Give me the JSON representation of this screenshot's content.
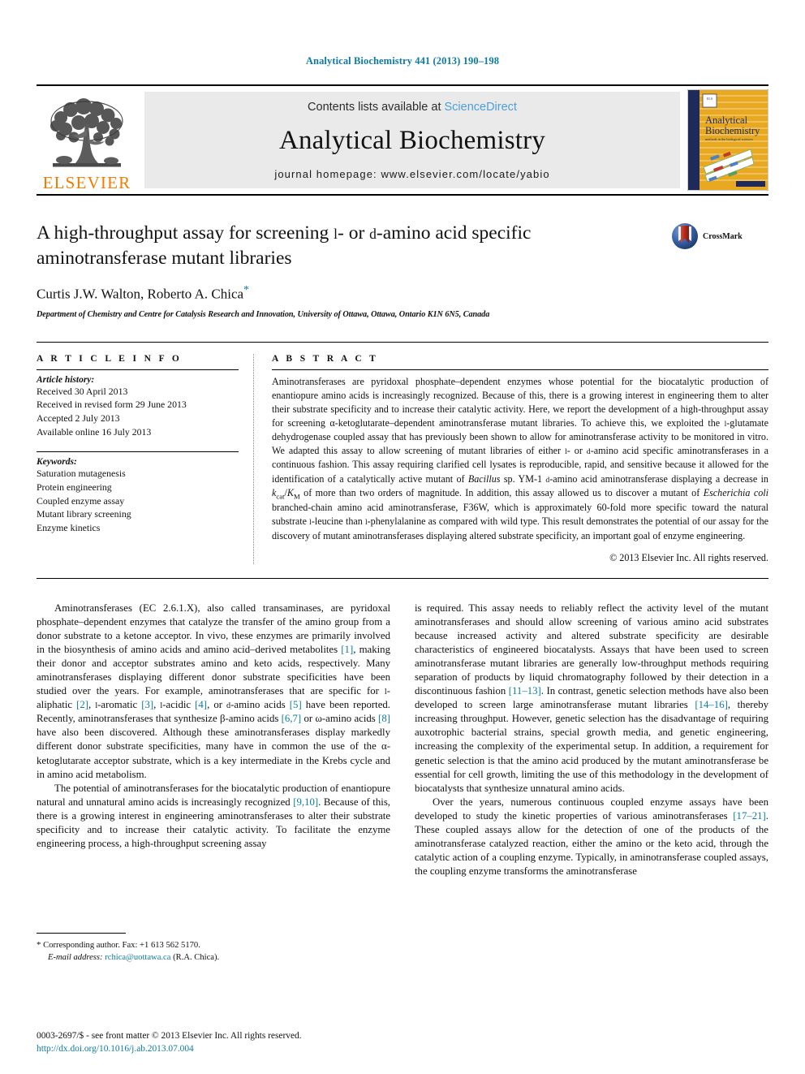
{
  "running_head": "Analytical Biochemistry 441 (2013) 190–198",
  "masthead": {
    "publisher_name": "ELSEVIER",
    "contents_prefix": "Contents lists available at ",
    "sciencedirect": "ScienceDirect",
    "journal_title": "Analytical Biochemistry",
    "homepage": "journal homepage: www.elsevier.com/locate/yabio",
    "cover_title_line1": "Analytical",
    "cover_title_line2": "Biochemistry",
    "cover_subtitle": "methods in the biological sciences",
    "colors": {
      "elsevier_orange": "#f07d00",
      "link_blue": "#4d9fd6",
      "accent_teal": "#0d7ba3",
      "masthead_grey": "#eaeaea",
      "cover_navy": "#1e2a5a",
      "cover_gold": "#e8a921"
    }
  },
  "title": {
    "line1_a": "A high-throughput assay for screening ",
    "line1_sc1": "l",
    "line1_b": "- or ",
    "line1_sc2": "d",
    "line1_c": "-amino acid specific",
    "line2": "aminotransferase mutant libraries",
    "full": "A high-throughput assay for screening L- or D-amino acid specific aminotransferase mutant libraries"
  },
  "authors": {
    "names": "Curtis J.W. Walton, Roberto A. Chica",
    "corresponding_marker": "*"
  },
  "affiliation": "Department of Chemistry and Centre for Catalysis Research and Innovation, University of Ottawa, Ottawa, Ontario K1N 6N5, Canada",
  "crossmark": {
    "label": "CrossMark"
  },
  "article_info": {
    "heading": "A R T I C L E   I N F O",
    "history_label": "Article history:",
    "history": [
      "Received 30 April 2013",
      "Received in revised form 29 June 2013",
      "Accepted 2 July 2013",
      "Available online 16 July 2013"
    ],
    "keywords_label": "Keywords:",
    "keywords": [
      "Saturation mutagenesis",
      "Protein engineering",
      "Coupled enzyme assay",
      "Mutant library screening",
      "Enzyme kinetics"
    ]
  },
  "abstract": {
    "heading": "A B S T R A C T",
    "parts": [
      {
        "t": "text",
        "v": "Aminotransferases are pyridoxal phosphate–dependent enzymes whose potential for the biocatalytic production of enantiopure amino acids is increasingly recognized. Because of this, there is a growing interest in engineering them to alter their substrate specificity and to increase their catalytic activity. Here, we report the development of a high-throughput assay for screening α-ketoglutarate–dependent aminotransferase mutant libraries. To achieve this, we exploited the "
      },
      {
        "t": "sc",
        "v": "l"
      },
      {
        "t": "text",
        "v": "-glutamate dehydrogenase coupled assay that has previously been shown to allow for aminotransferase activity to be monitored in vitro. We adapted this assay to allow screening of mutant libraries of either "
      },
      {
        "t": "sc",
        "v": "l"
      },
      {
        "t": "text",
        "v": "- or "
      },
      {
        "t": "sc",
        "v": "d"
      },
      {
        "t": "text",
        "v": "-amino acid specific aminotransferases in a continuous fashion. This assay requiring clarified cell lysates is reproducible, rapid, and sensitive because it allowed for the identification of a catalytically active mutant of "
      },
      {
        "t": "it",
        "v": "Bacillus"
      },
      {
        "t": "text",
        "v": " sp. YM-1 "
      },
      {
        "t": "sc",
        "v": "d"
      },
      {
        "t": "text",
        "v": "-amino acid aminotransferase displaying a decrease in "
      },
      {
        "t": "kcatkm",
        "v": "kcat/KM"
      },
      {
        "t": "text",
        "v": " of more than two orders of magnitude. In addition, this assay allowed us to discover a mutant of "
      },
      {
        "t": "it",
        "v": "Escherichia coli"
      },
      {
        "t": "text",
        "v": " branched-chain amino acid aminotransferase, F36W, which is approximately 60-fold more specific toward the natural substrate "
      },
      {
        "t": "sc",
        "v": "l"
      },
      {
        "t": "text",
        "v": "-leucine than "
      },
      {
        "t": "sc",
        "v": "l"
      },
      {
        "t": "text",
        "v": "-phenylalanine as compared with wild type. This result demonstrates the potential of our assay for the discovery of mutant aminotransferases displaying altered substrate specificity, an important goal of enzyme engineering."
      }
    ],
    "copyright": "© 2013 Elsevier Inc. All rights reserved."
  },
  "body": {
    "left_column": [
      {
        "indent": true,
        "parts": [
          {
            "t": "text",
            "v": "Aminotransferases (EC 2.6.1.X), also called transaminases, are pyridoxal phosphate–dependent enzymes that catalyze the transfer of the amino group from a donor substrate to a ketone acceptor. In vivo, these enzymes are primarily involved in the biosynthesis of amino acids and amino acid–derived metabolites "
          },
          {
            "t": "ref",
            "v": "[1]"
          },
          {
            "t": "text",
            "v": ", making their donor and acceptor substrates amino and keto acids, respectively. Many aminotransferases displaying different donor substrate specificities have been studied over the years. For example, aminotransferases that are specific for "
          },
          {
            "t": "sc",
            "v": "l"
          },
          {
            "t": "text",
            "v": "-aliphatic "
          },
          {
            "t": "ref",
            "v": "[2]"
          },
          {
            "t": "text",
            "v": ", "
          },
          {
            "t": "sc",
            "v": "l"
          },
          {
            "t": "text",
            "v": "-aromatic "
          },
          {
            "t": "ref",
            "v": "[3]"
          },
          {
            "t": "text",
            "v": ", "
          },
          {
            "t": "sc",
            "v": "l"
          },
          {
            "t": "text",
            "v": "-acidic "
          },
          {
            "t": "ref",
            "v": "[4]"
          },
          {
            "t": "text",
            "v": ", or "
          },
          {
            "t": "sc",
            "v": "d"
          },
          {
            "t": "text",
            "v": "-amino acids "
          },
          {
            "t": "ref",
            "v": "[5]"
          },
          {
            "t": "text",
            "v": " have been reported. Recently, aminotransferases that synthesize β-amino acids "
          },
          {
            "t": "ref",
            "v": "[6,7]"
          },
          {
            "t": "text",
            "v": " or ω-amino acids "
          },
          {
            "t": "ref",
            "v": "[8]"
          },
          {
            "t": "text",
            "v": " have also been discovered. Although these aminotransferases display markedly different donor substrate specificities, many have in common the use of the α-ketoglutarate acceptor substrate, which is a key intermediate in the Krebs cycle and in amino acid metabolism."
          }
        ]
      },
      {
        "indent": true,
        "parts": [
          {
            "t": "text",
            "v": "The potential of aminotransferases for the biocatalytic production of enantiopure natural and unnatural amino acids is increasingly recognized "
          },
          {
            "t": "ref",
            "v": "[9,10]"
          },
          {
            "t": "text",
            "v": ". Because of this, there is a growing interest in engineering aminotransferases to alter their substrate specificity and to increase their catalytic activity. To facilitate the enzyme engineering process, a high-throughput screening assay"
          }
        ]
      }
    ],
    "right_column": [
      {
        "indent": false,
        "parts": [
          {
            "t": "text",
            "v": "is required. This assay needs to reliably reflect the activity level of the mutant aminotransferases and should allow screening of various amino acid substrates because increased activity and altered substrate specificity are desirable characteristics of engineered biocatalysts. Assays that have been used to screen aminotransferase mutant libraries are generally low-throughput methods requiring separation of products by liquid chromatography followed by their detection in a discontinuous fashion "
          },
          {
            "t": "ref",
            "v": "[11–13]"
          },
          {
            "t": "text",
            "v": ". In contrast, genetic selection methods have also been developed to screen large aminotransferase mutant libraries "
          },
          {
            "t": "ref",
            "v": "[14–16]"
          },
          {
            "t": "text",
            "v": ", thereby increasing throughput. However, genetic selection has the disadvantage of requiring auxotrophic bacterial strains, special growth media, and genetic engineering, increasing the complexity of the experimental setup. In addition, a requirement for genetic selection is that the amino acid produced by the mutant aminotransferase be essential for cell growth, limiting the use of this methodology in the development of biocatalysts that synthesize unnatural amino acids."
          }
        ]
      },
      {
        "indent": true,
        "parts": [
          {
            "t": "text",
            "v": "Over the years, numerous continuous coupled enzyme assays have been developed to study the kinetic properties of various aminotransferases "
          },
          {
            "t": "ref",
            "v": "[17–21]"
          },
          {
            "t": "text",
            "v": ". These coupled assays allow for the detection of one of the products of the aminotransferase catalyzed reaction, either the amino or the keto acid, through the catalytic action of a coupling enzyme. Typically, in aminotransferase coupled assays, the coupling enzyme transforms the aminotransferase"
          }
        ]
      }
    ]
  },
  "footnote": {
    "marker": "*",
    "corresponding": "Corresponding author. Fax: +1 613 562 5170.",
    "email_label": "E-mail address:",
    "email": "rchica@uottawa.ca",
    "email_owner": "(R.A. Chica)."
  },
  "page_footer": {
    "issn_line": "0003-2697/$ - see front matter © 2013 Elsevier Inc. All rights reserved.",
    "doi": "http://dx.doi.org/10.1016/j.ab.2013.07.004"
  }
}
